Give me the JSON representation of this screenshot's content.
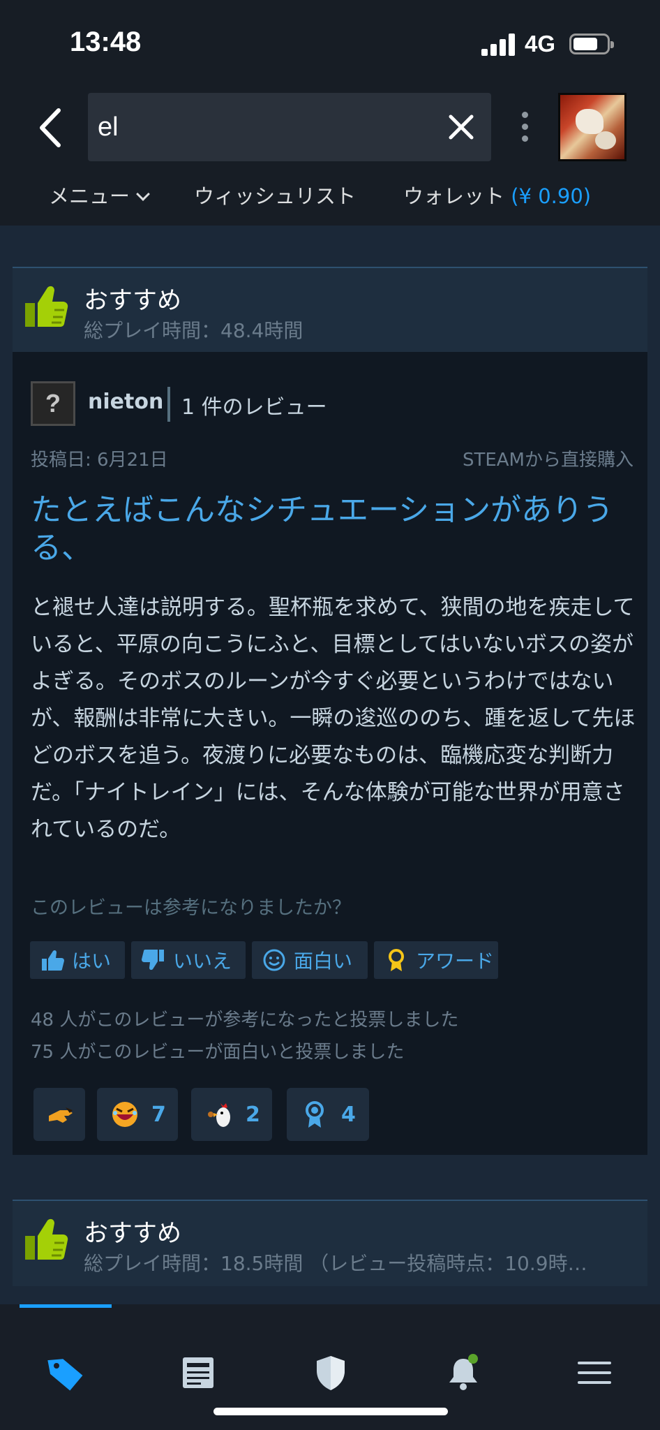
{
  "status_bar": {
    "time": "13:48",
    "network": "4G",
    "icons": [
      "signal-icon",
      "battery-icon"
    ]
  },
  "header": {
    "search": {
      "value": "el",
      "placeholder": ""
    },
    "icons": [
      "back-arrow-icon",
      "close-icon",
      "kebab-menu-icon",
      "user-avatar"
    ]
  },
  "nav": {
    "menu_label": "メニュー",
    "wishlist_label": "ウィッシュリスト",
    "wallet_label": "ウォレット",
    "wallet_amount": "(¥ 0.90)"
  },
  "review": {
    "recommendation": "おすすめ",
    "hours": "総プレイ時間：48.4時間",
    "author_avatar_glyph": "?",
    "author": "nieton",
    "review_count": "1 件のレビュー",
    "posted": "投稿日: 6月21日",
    "purchase_source": "STEAMから直接購入",
    "title": "たとえばこんなシチュエーションがありうる、",
    "body": "と褪せ人達は説明する。聖杯瓶を求めて、狭間の地を疾走していると、平原の向こうにふと、目標としてはいないボスの姿がよぎる。そのボスのルーンが今すぐ必要というわけではないが、報酬は非常に大きい。一瞬の逡巡ののち、踵を返して先ほどのボスを追う。夜渡りに必要なものは、臨機応変な判断力だ。「ナイトレイン」には、そんな体験が可能な世界が用意されているのだ。",
    "helpful_question": "このレビューは参考になりましたか？",
    "buttons": {
      "yes": "はい",
      "no": "いいえ",
      "funny": "面白い",
      "award": "アワード"
    },
    "helpful_stat": "48 人がこのレビューが参考になったと投票しました",
    "funny_stat": "75 人がこのレビューが面白いと投票しました",
    "reactions": [
      {
        "icon": "pointing-hand-icon",
        "count": ""
      },
      {
        "icon": "laughing-face-icon",
        "count": "7"
      },
      {
        "icon": "rooster-icon",
        "count": "2"
      },
      {
        "icon": "award-ribbon-icon",
        "count": "4"
      }
    ]
  },
  "review2": {
    "recommendation": "おすすめ",
    "hours": "総プレイ時間：18.5時間 （レビュー投稿時点：10.9時…"
  },
  "tabbar": {
    "tabs": [
      "store-tag-icon",
      "news-icon",
      "shield-icon",
      "bell-icon",
      "menu-icon"
    ],
    "active": "store-tag-icon"
  },
  "colors": {
    "accent": "#1a9fff",
    "link": "#4aa8e8",
    "thumb_green": "#a4d007",
    "background": "#1b2838"
  }
}
